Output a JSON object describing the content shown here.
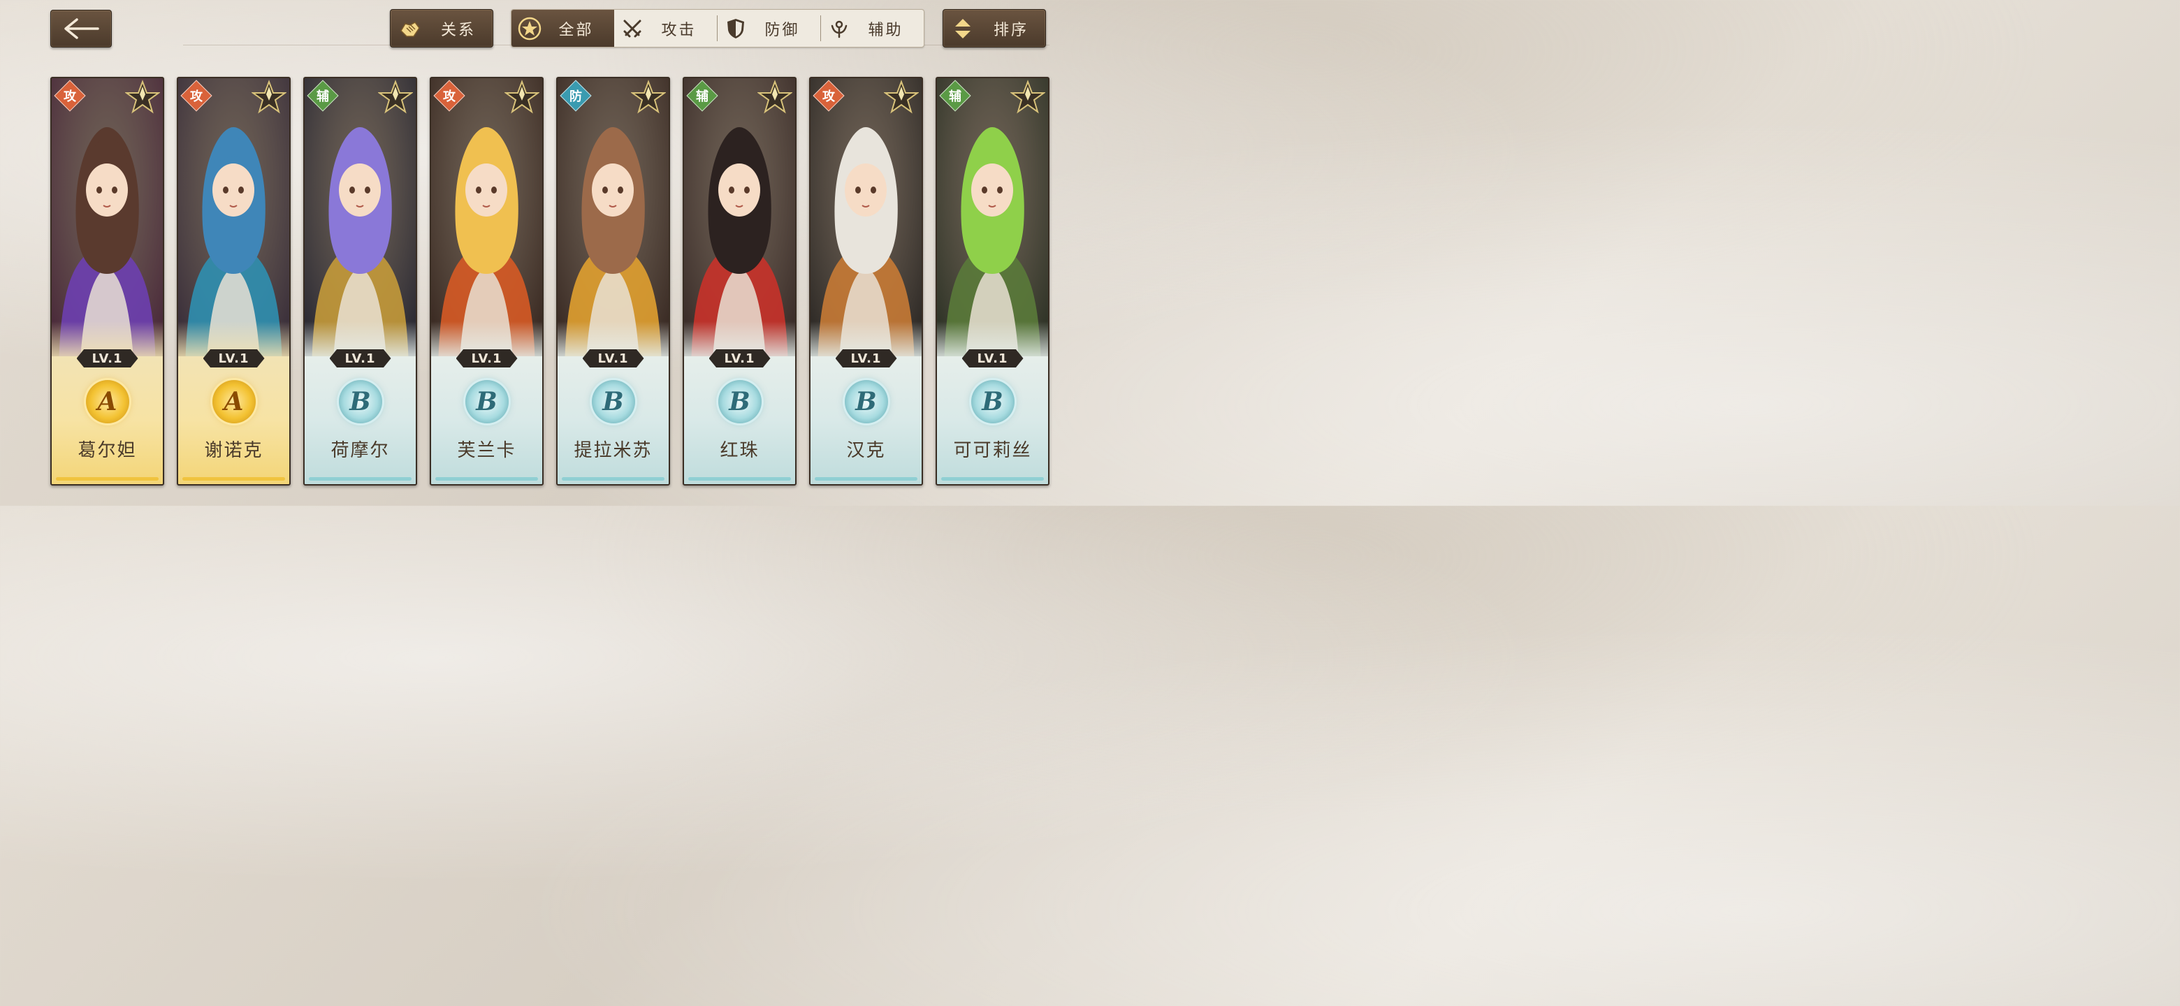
{
  "header": {
    "back_icon": "back-arrow-icon",
    "relation": {
      "label": "关系",
      "icon": "handshake-icon"
    },
    "filters": [
      {
        "label": "全部",
        "icon": "star-circle-icon",
        "active": true
      },
      {
        "label": "攻击",
        "icon": "crossed-swords-icon",
        "active": false
      },
      {
        "label": "防御",
        "icon": "shield-icon",
        "active": false
      },
      {
        "label": "辅助",
        "icon": "support-icon",
        "active": false
      }
    ],
    "sort": {
      "label": "排序",
      "icon": "sort-arrows-icon"
    }
  },
  "characters": [
    {
      "name": "葛尔妲",
      "role": "攻",
      "level": "LV.1",
      "rank": "A",
      "hair": "#5a3a2e",
      "accent": "#6d3fb0",
      "bg": "#4a2a3a"
    },
    {
      "name": "谢诺克",
      "role": "攻",
      "level": "LV.1",
      "rank": "A",
      "hair": "#3f86b8",
      "accent": "#2f8fb0",
      "bg": "#3a2f3a"
    },
    {
      "name": "荷摩尔",
      "role": "辅",
      "level": "LV.1",
      "rank": "B",
      "hair": "#8a78d8",
      "accent": "#c49a3a",
      "bg": "#2b2a33"
    },
    {
      "name": "芙兰卡",
      "role": "攻",
      "level": "LV.1",
      "rank": "B",
      "hair": "#f0c050",
      "accent": "#d65a25",
      "bg": "#3a2a22"
    },
    {
      "name": "提拉米苏",
      "role": "防",
      "level": "LV.1",
      "rank": "B",
      "hair": "#9c6a4a",
      "accent": "#e0a030",
      "bg": "#3a2b24"
    },
    {
      "name": "红珠",
      "role": "辅",
      "level": "LV.1",
      "rank": "B",
      "hair": "#2c2220",
      "accent": "#c8322a",
      "bg": "#3a2c28"
    },
    {
      "name": "汉克",
      "role": "攻",
      "level": "LV.1",
      "rank": "B",
      "hair": "#e8e4dc",
      "accent": "#c77a35",
      "bg": "#2e2a26"
    },
    {
      "name": "可可莉丝",
      "role": "辅",
      "level": "LV.1",
      "rank": "B",
      "hair": "#8fd04a",
      "accent": "#5a7a3a",
      "bg": "#2e3326"
    }
  ]
}
